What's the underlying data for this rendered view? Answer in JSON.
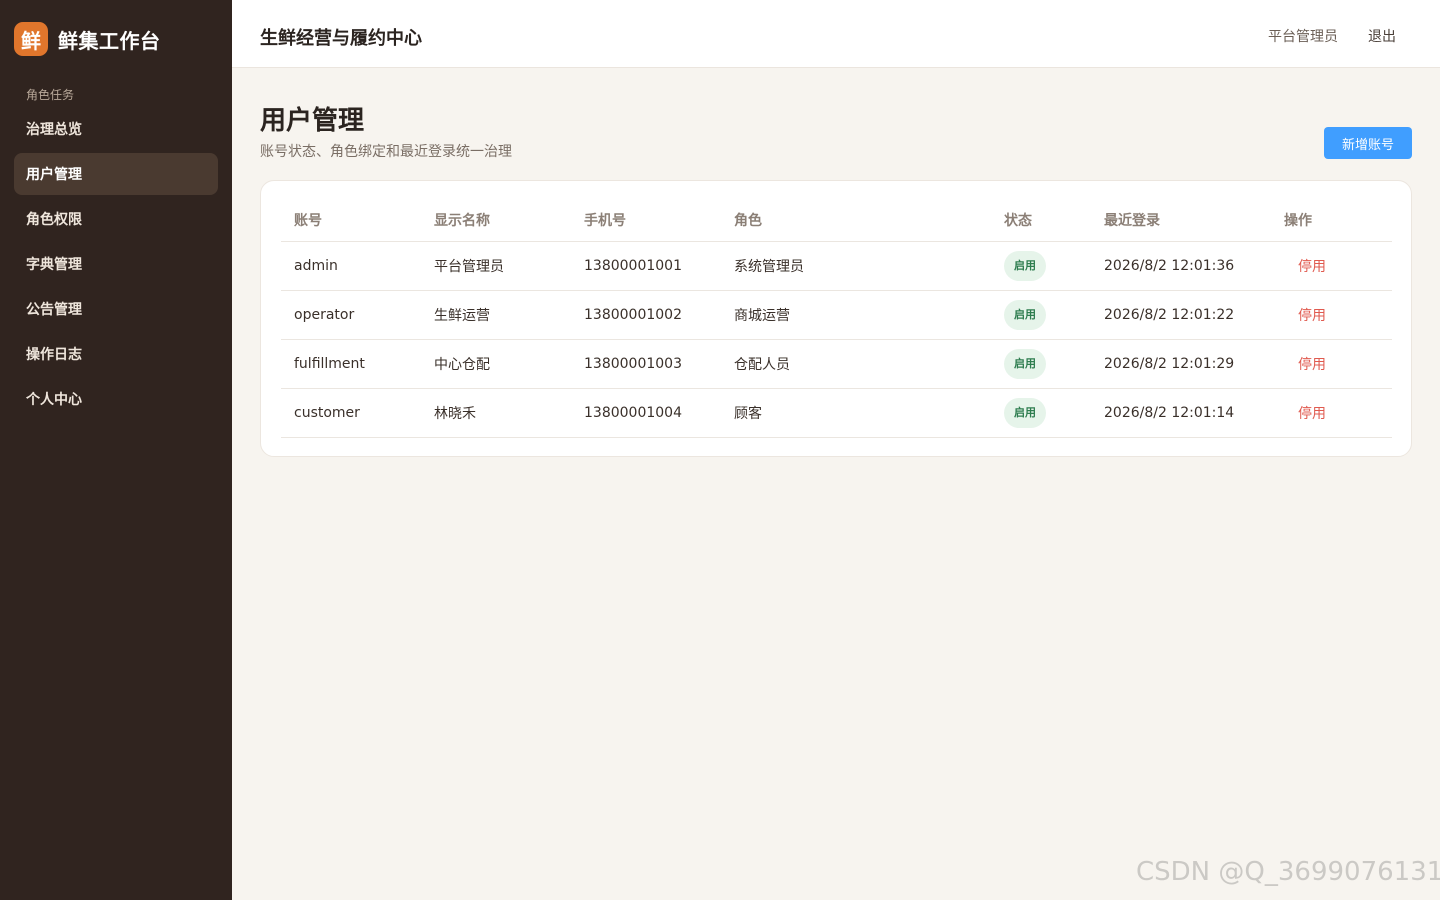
{
  "sidebar": {
    "brand": {
      "logo_char": "鲜",
      "name": "鲜集工作台"
    },
    "section_label": "角色任务",
    "items": [
      {
        "label": "治理总览",
        "active": false
      },
      {
        "label": "用户管理",
        "active": true
      },
      {
        "label": "角色权限",
        "active": false
      },
      {
        "label": "字典管理",
        "active": false
      },
      {
        "label": "公告管理",
        "active": false
      },
      {
        "label": "操作日志",
        "active": false
      },
      {
        "label": "个人中心",
        "active": false
      }
    ]
  },
  "topbar": {
    "title": "生鲜经营与履约中心",
    "user": "平台管理员",
    "logout": "退出"
  },
  "page": {
    "title": "用户管理",
    "subtitle": "账号状态、角色绑定和最近登录统一治理",
    "add_button": "新增账号"
  },
  "table": {
    "columns": [
      "账号",
      "显示名称",
      "手机号",
      "角色",
      "状态",
      "最近登录",
      "操作"
    ],
    "rows": [
      {
        "account": "admin",
        "display_name": "平台管理员",
        "phone": "13800001001",
        "role": "系统管理员",
        "status": "启用",
        "last_login": "2026/8/2 12:01:36",
        "action": "停用"
      },
      {
        "account": "operator",
        "display_name": "生鲜运营",
        "phone": "13800001002",
        "role": "商城运营",
        "status": "启用",
        "last_login": "2026/8/2 12:01:22",
        "action": "停用"
      },
      {
        "account": "fulfillment",
        "display_name": "中心仓配",
        "phone": "13800001003",
        "role": "仓配人员",
        "status": "启用",
        "last_login": "2026/8/2 12:01:29",
        "action": "停用"
      },
      {
        "account": "customer",
        "display_name": "林晓禾",
        "phone": "13800001004",
        "role": "顾客",
        "status": "启用",
        "last_login": "2026/8/2 12:01:14",
        "action": "停用"
      }
    ]
  },
  "watermark": "CSDN @Q_3699076131",
  "colors": {
    "sidebar_bg": "#30241f",
    "brand_accent": "#e0762c",
    "primary_button": "#409eff",
    "status_badge_bg": "#e6f4ea",
    "status_badge_text": "#2e7d4f",
    "danger_link": "#e05a4f"
  }
}
